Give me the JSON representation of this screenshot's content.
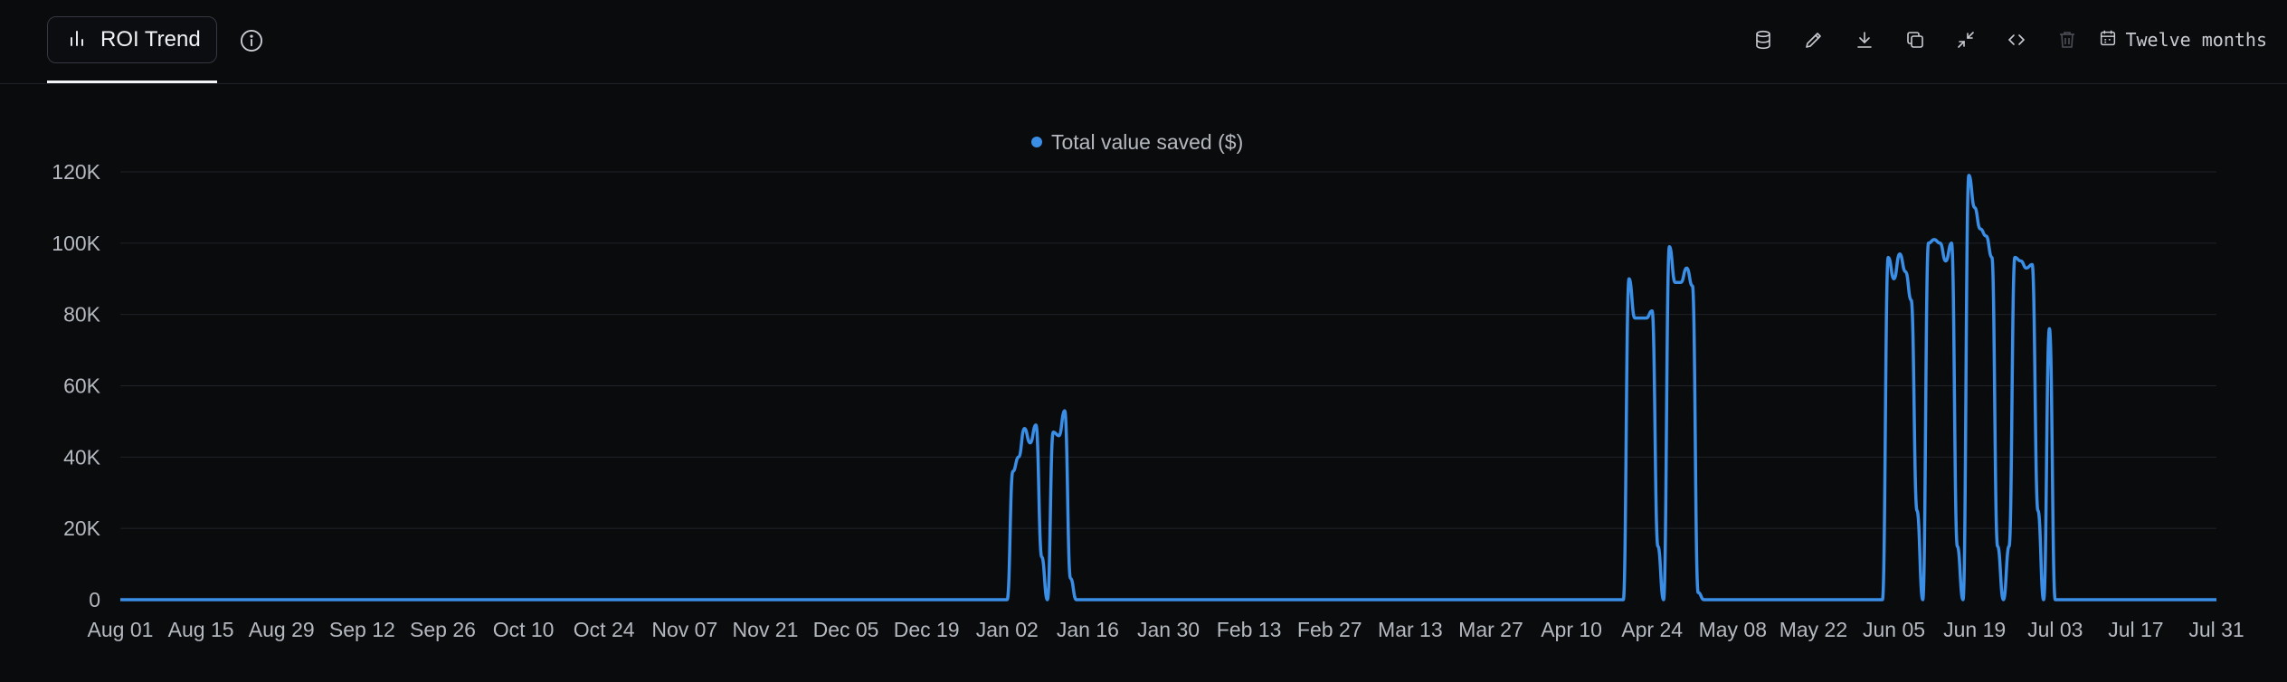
{
  "header": {
    "tab_title": "ROI Trend",
    "icons": {
      "tab": "bar-chart-icon",
      "info": "info-icon",
      "toolbar": [
        "database-icon",
        "edit-icon",
        "download-icon",
        "copy-icon",
        "collapse-icon",
        "code-icon",
        "trash-icon",
        "calendar-icon"
      ]
    },
    "range_label": "Twelve months"
  },
  "colors": {
    "background": "#0a0b0d",
    "series": "#3b8ee6",
    "grid": "#1f2228",
    "axis_text": "#b4b8bf"
  },
  "chart_data": {
    "type": "line",
    "title": "",
    "legend": "top-center",
    "grid": true,
    "xlabel": "",
    "ylabel": "",
    "ylim": [
      0,
      120000
    ],
    "y_ticks": [
      "0",
      "20K",
      "40K",
      "60K",
      "80K",
      "100K",
      "120K"
    ],
    "x_start": "2024-08-01",
    "x_end": "2025-07-31",
    "x_ticks": [
      "Aug 01",
      "Aug 15",
      "Aug 29",
      "Sep 12",
      "Sep 26",
      "Oct 10",
      "Oct 24",
      "Nov 07",
      "Nov 21",
      "Dec 05",
      "Dec 19",
      "Jan 02",
      "Jan 16",
      "Jan 30",
      "Feb 13",
      "Feb 27",
      "Mar 13",
      "Mar 27",
      "Apr 10",
      "Apr 24",
      "May 08",
      "May 22",
      "Jun 05",
      "Jun 19",
      "Jul 03",
      "Jul 17",
      "Jul 31"
    ],
    "series": [
      {
        "name": "Total value saved ($)",
        "color": "#3b8ee6",
        "points": [
          [
            "2024-08-01",
            0
          ],
          [
            "2025-01-02",
            0
          ],
          [
            "2025-01-03",
            36000
          ],
          [
            "2025-01-04",
            40000
          ],
          [
            "2025-01-05",
            48000
          ],
          [
            "2025-01-06",
            44000
          ],
          [
            "2025-01-07",
            49000
          ],
          [
            "2025-01-08",
            12000
          ],
          [
            "2025-01-09",
            0
          ],
          [
            "2025-01-10",
            47000
          ],
          [
            "2025-01-11",
            46000
          ],
          [
            "2025-01-12",
            53000
          ],
          [
            "2025-01-13",
            6000
          ],
          [
            "2025-01-14",
            0
          ],
          [
            "2025-04-19",
            0
          ],
          [
            "2025-04-20",
            90000
          ],
          [
            "2025-04-21",
            79000
          ],
          [
            "2025-04-22",
            79000
          ],
          [
            "2025-04-23",
            79000
          ],
          [
            "2025-04-24",
            81000
          ],
          [
            "2025-04-25",
            15000
          ],
          [
            "2025-04-26",
            0
          ],
          [
            "2025-04-27",
            99000
          ],
          [
            "2025-04-28",
            89000
          ],
          [
            "2025-04-29",
            89000
          ],
          [
            "2025-04-30",
            93000
          ],
          [
            "2025-05-01",
            88000
          ],
          [
            "2025-05-02",
            2000
          ],
          [
            "2025-05-03",
            0
          ],
          [
            "2025-06-03",
            0
          ],
          [
            "2025-06-04",
            96000
          ],
          [
            "2025-06-05",
            90000
          ],
          [
            "2025-06-06",
            97000
          ],
          [
            "2025-06-07",
            92000
          ],
          [
            "2025-06-08",
            84000
          ],
          [
            "2025-06-09",
            25000
          ],
          [
            "2025-06-10",
            0
          ],
          [
            "2025-06-11",
            100000
          ],
          [
            "2025-06-12",
            101000
          ],
          [
            "2025-06-13",
            100000
          ],
          [
            "2025-06-14",
            95000
          ],
          [
            "2025-06-15",
            100000
          ],
          [
            "2025-06-16",
            15000
          ],
          [
            "2025-06-17",
            0
          ],
          [
            "2025-06-18",
            119000
          ],
          [
            "2025-06-19",
            110000
          ],
          [
            "2025-06-20",
            104000
          ],
          [
            "2025-06-21",
            102000
          ],
          [
            "2025-06-22",
            96000
          ],
          [
            "2025-06-23",
            15000
          ],
          [
            "2025-06-24",
            0
          ],
          [
            "2025-06-25",
            15000
          ],
          [
            "2025-06-26",
            96000
          ],
          [
            "2025-06-27",
            95000
          ],
          [
            "2025-06-28",
            93000
          ],
          [
            "2025-06-29",
            94000
          ],
          [
            "2025-06-30",
            25000
          ],
          [
            "2025-07-01",
            0
          ],
          [
            "2025-07-02",
            76000
          ],
          [
            "2025-07-03",
            0
          ],
          [
            "2025-07-31",
            0
          ]
        ]
      }
    ]
  }
}
